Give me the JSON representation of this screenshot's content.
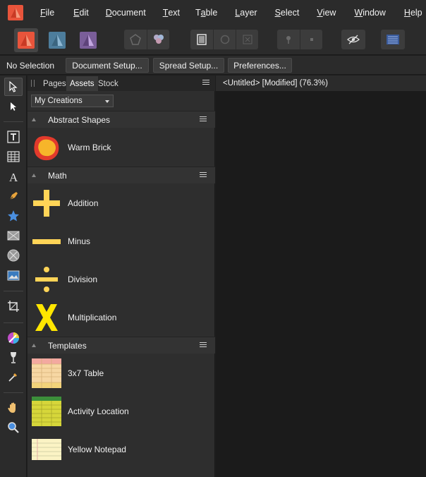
{
  "menubar": {
    "items": [
      {
        "pre": "",
        "mn": "F",
        "post": "ile"
      },
      {
        "pre": "",
        "mn": "E",
        "post": "dit"
      },
      {
        "pre": "",
        "mn": "D",
        "post": "ocument"
      },
      {
        "pre": "",
        "mn": "T",
        "post": "ext"
      },
      {
        "pre": "T",
        "mn": "a",
        "post": "ble"
      },
      {
        "pre": "",
        "mn": "L",
        "post": "ayer"
      },
      {
        "pre": "",
        "mn": "S",
        "post": "elect"
      },
      {
        "pre": "",
        "mn": "V",
        "post": "iew"
      },
      {
        "pre": "",
        "mn": "W",
        "post": "indow"
      },
      {
        "pre": "",
        "mn": "H",
        "post": "elp"
      }
    ]
  },
  "contextbar": {
    "selection_label": "No Selection",
    "document_setup": "Document Setup...",
    "spread_setup": "Spread Setup...",
    "preferences": "Preferences..."
  },
  "panel": {
    "tabs": [
      "Pages",
      "Assets",
      "Stock"
    ],
    "category": "My Creations",
    "sections": [
      {
        "title": "Abstract Shapes",
        "assets": [
          "Warm Brick"
        ]
      },
      {
        "title": "Math",
        "assets": [
          "Addition",
          "Minus",
          "Division",
          "Multiplication"
        ]
      },
      {
        "title": "Templates",
        "assets": [
          "3x7 Table",
          "Activity Location",
          "Yellow Notepad"
        ]
      }
    ]
  },
  "document": {
    "tab_title": "<Untitled> [Modified] (76.3%)"
  },
  "colors": {
    "accent_orange": "#e8543b",
    "math_yellow": "#ffd457",
    "multiply_yellow": "#ffe600",
    "panel_bg": "#2e2e2e"
  }
}
